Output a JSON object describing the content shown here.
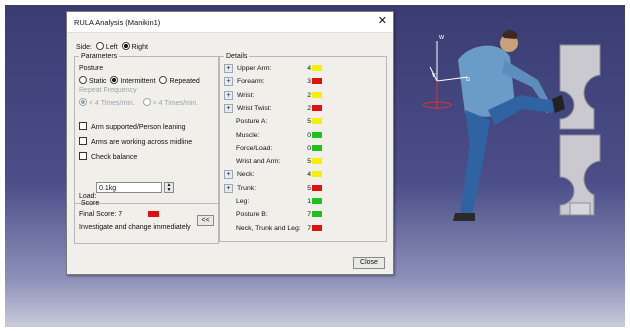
{
  "dialog": {
    "title": "RULA Analysis (Manikin1)",
    "close_glyph": "✕",
    "side": {
      "label": "Side:",
      "options": [
        "Left",
        "Right"
      ],
      "selected": "Right"
    },
    "parameters": {
      "legend": "Parameters",
      "posture_label": "Posture",
      "posture_options": [
        "Static",
        "Intermittent",
        "Repeated"
      ],
      "posture_selected": "Intermittent",
      "repeat_label": "Repeat Frequency",
      "repeat_options": [
        "< 4 Times/min.",
        "> 4 Times/min."
      ],
      "repeat_selected": "< 4 Times/min.",
      "checkboxes": [
        "Arm supported/Person leaning",
        "Arms are working across midline",
        "Check balance"
      ],
      "load_label": "Load:",
      "load_value": "0.1kg"
    },
    "score": {
      "legend": "Score",
      "final_label": "Final Score: 7",
      "final_color": "#e01010",
      "message": "Investigate and change immediately",
      "collapse_label": "<<"
    },
    "details": {
      "legend": "Details",
      "rows": [
        {
          "label": "Upper Arm:",
          "value": "4",
          "color": "#f4f000",
          "expand": "+"
        },
        {
          "label": "Forearm:",
          "value": "3",
          "color": "#e01010",
          "expand": "+"
        },
        {
          "label": "Wrist:",
          "value": "2",
          "color": "#f4f000",
          "expand": "+"
        },
        {
          "label": "Wrist Twist:",
          "value": "2",
          "color": "#e01010",
          "expand": "+"
        },
        {
          "label": "Posture A:",
          "value": "5",
          "color": "#f4f000",
          "expand": ""
        },
        {
          "label": "Muscle:",
          "value": "0",
          "color": "#20c020",
          "expand": ""
        },
        {
          "label": "Force/Load:",
          "value": "0",
          "color": "#20c020",
          "expand": ""
        },
        {
          "label": "Wrist and Arm:",
          "value": "5",
          "color": "#f4f000",
          "expand": ""
        },
        {
          "label": "Neck:",
          "value": "4",
          "color": "#f4f000",
          "expand": "+"
        },
        {
          "label": "Trunk:",
          "value": "5",
          "color": "#e01010",
          "expand": "+"
        },
        {
          "label": "Leg:",
          "value": "1",
          "color": "#20c020",
          "expand": ""
        },
        {
          "label": "Posture B:",
          "value": "7",
          "color": "#20c020",
          "expand": ""
        },
        {
          "label": "Neck, Trunk and Leg:",
          "value": "7",
          "color": "#e01010",
          "expand": ""
        }
      ]
    },
    "close_button": "Close"
  },
  "viewport": {
    "axis_labels": [
      "w",
      "v",
      "u"
    ]
  }
}
